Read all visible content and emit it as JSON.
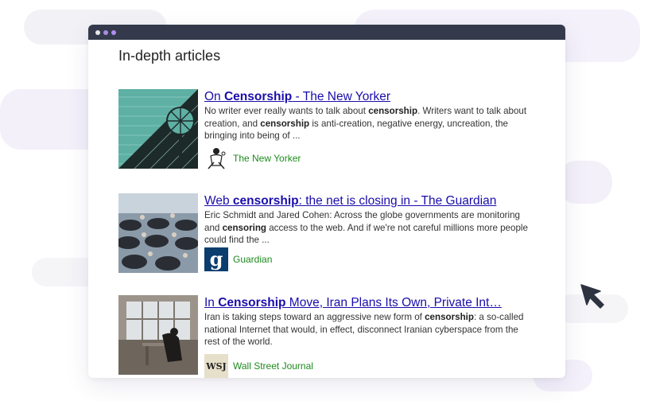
{
  "panel": {
    "heading": "In-depth articles"
  },
  "articles": [
    {
      "title_pre": "On ",
      "title_bold": "Censorship",
      "title_post": " - The New Yorker",
      "snippet": [
        {
          "t": "No writer ever really wants to talk about ",
          "b": false
        },
        {
          "t": "censorship",
          "b": true
        },
        {
          "t": ". Writers want to talk about creation, and ",
          "b": false
        },
        {
          "t": "censorship",
          "b": true
        },
        {
          "t": " is anti-creation, negative energy, uncreation, the bringing into being of ...",
          "b": false
        }
      ],
      "source": "The New Yorker",
      "logo_icon": "new-yorker-logo-icon"
    },
    {
      "title_pre": "Web ",
      "title_bold": "censorship",
      "title_post": ": the net is closing in - The Guardian",
      "snippet": [
        {
          "t": "Eric Schmidt and Jared Cohen: Across the globe governments are monitoring and ",
          "b": false
        },
        {
          "t": "censoring",
          "b": true
        },
        {
          "t": " access to the web. And if we're not careful millions more people could find the ...",
          "b": false
        }
      ],
      "source": "Guardian",
      "logo_icon": "guardian-logo-icon",
      "logo_text": "g"
    },
    {
      "title_pre": "In ",
      "title_bold": "Censorship",
      "title_post": " Move, Iran Plans Its Own, Private Int…",
      "snippet": [
        {
          "t": "Iran is taking steps toward an aggressive new form of ",
          "b": false
        },
        {
          "t": "censorship",
          "b": true
        },
        {
          "t": ": a so-called national Internet that would, in effect, disconnect Iranian cyberspace from the rest of the world.",
          "b": false
        }
      ],
      "source": "Wall Street Journal",
      "logo_icon": "wsj-logo-icon",
      "logo_text": "WSJ"
    }
  ],
  "colors": {
    "link": "#1a0dab",
    "source": "#1e8a1e",
    "titlebar": "#343a4b"
  }
}
